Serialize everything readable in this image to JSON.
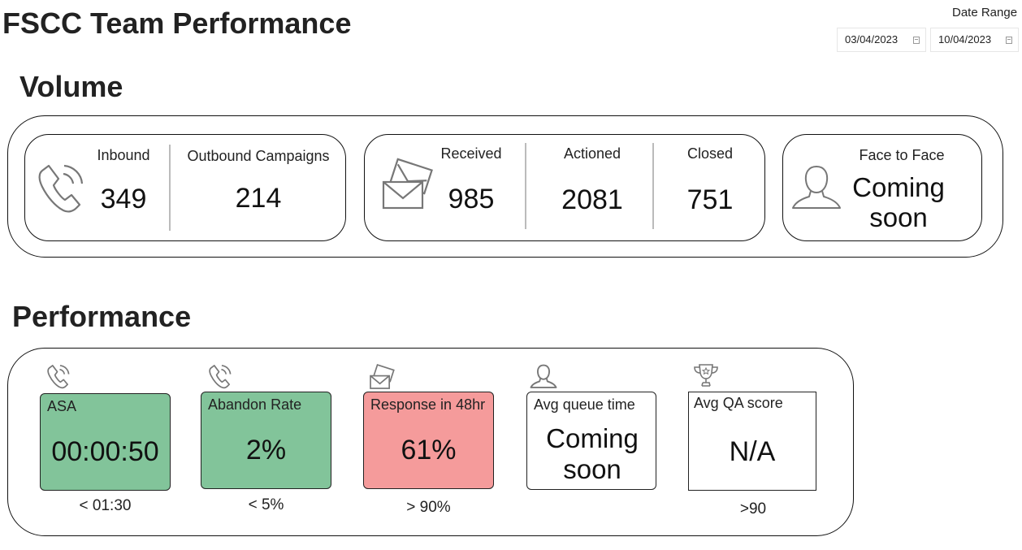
{
  "page": {
    "title": "FSCC Team Performance"
  },
  "date_range": {
    "label": "Date Range",
    "start": "03/04/2023",
    "end": "10/04/2023"
  },
  "volume": {
    "title": "Volume",
    "phone": {
      "inbound_label": "Inbound",
      "inbound_value": "349",
      "outbound_label": "Outbound Campaigns",
      "outbound_value": "214"
    },
    "email": {
      "received_label": "Received",
      "received_value": "985",
      "actioned_label": "Actioned",
      "actioned_value": "2081",
      "closed_label": "Closed",
      "closed_value": "751"
    },
    "face": {
      "label": "Face to Face",
      "line1": "Coming",
      "line2": "soon"
    }
  },
  "performance": {
    "title": "Performance",
    "asa": {
      "label": "ASA",
      "value": "00:00:50",
      "target": "< 01:30",
      "status_color": "#82c49a"
    },
    "abandon": {
      "label": "Abandon Rate",
      "value": "2%",
      "target": "< 5%",
      "status_color": "#82c49a"
    },
    "response": {
      "label": "Response in 48hr",
      "value": "61%",
      "target": "> 90%",
      "status_color": "#f59b9b"
    },
    "queue": {
      "label": "Avg queue time",
      "line1": "Coming",
      "line2": "soon"
    },
    "qa": {
      "label": "Avg QA score",
      "value": "N/A",
      "target": ">90"
    }
  },
  "icons": [
    "phone-icon",
    "envelope-icon",
    "person-icon",
    "trophy-icon",
    "calendar-icon"
  ]
}
